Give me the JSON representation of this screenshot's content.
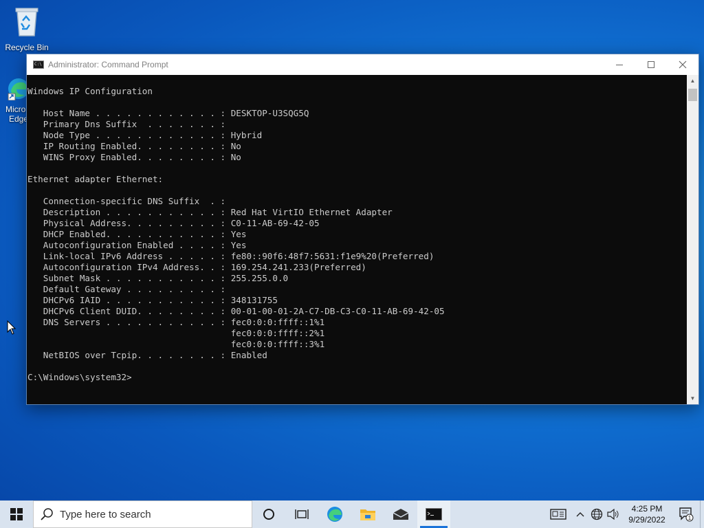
{
  "desktop": {
    "icons": [
      {
        "label": "Recycle Bin"
      },
      {
        "label": "Microsoft Edge"
      }
    ]
  },
  "window": {
    "title": "Administrator: Command Prompt",
    "controls": [
      "minimize",
      "maximize",
      "close"
    ],
    "console_lines": [
      "Windows IP Configuration",
      "",
      "   Host Name . . . . . . . . . . . . : DESKTOP-U3SQG5Q",
      "   Primary Dns Suffix  . . . . . . . :",
      "   Node Type . . . . . . . . . . . . : Hybrid",
      "   IP Routing Enabled. . . . . . . . : No",
      "   WINS Proxy Enabled. . . . . . . . : No",
      "",
      "Ethernet adapter Ethernet:",
      "",
      "   Connection-specific DNS Suffix  . :",
      "   Description . . . . . . . . . . . : Red Hat VirtIO Ethernet Adapter",
      "   Physical Address. . . . . . . . . : C0-11-AB-69-42-05",
      "   DHCP Enabled. . . . . . . . . . . : Yes",
      "   Autoconfiguration Enabled . . . . : Yes",
      "   Link-local IPv6 Address . . . . . : fe80::90f6:48f7:5631:f1e9%20(Preferred)",
      "   Autoconfiguration IPv4 Address. . : 169.254.241.233(Preferred)",
      "   Subnet Mask . . . . . . . . . . . : 255.255.0.0",
      "   Default Gateway . . . . . . . . . :",
      "   DHCPv6 IAID . . . . . . . . . . . : 348131755",
      "   DHCPv6 Client DUID. . . . . . . . : 00-01-00-01-2A-C7-DB-C3-C0-11-AB-69-42-05",
      "   DNS Servers . . . . . . . . . . . : fec0:0:0:ffff::1%1",
      "                                       fec0:0:0:ffff::2%1",
      "                                       fec0:0:0:ffff::3%1",
      "   NetBIOS over Tcpip. . . . . . . . : Enabled",
      "",
      "C:\\Windows\\system32>"
    ]
  },
  "taskbar": {
    "search_placeholder": "Type here to search",
    "apps": [
      "cortana",
      "task-view",
      "edge",
      "file-explorer",
      "mail",
      "command-prompt"
    ],
    "active_app": "command-prompt",
    "clock_time": "4:25 PM",
    "clock_date": "9/29/2022",
    "notification_count": "1"
  },
  "colors": {
    "console_bg": "#0c0c0c",
    "console_fg": "#cccccc",
    "taskbar_bg": "#d9e3ef"
  }
}
